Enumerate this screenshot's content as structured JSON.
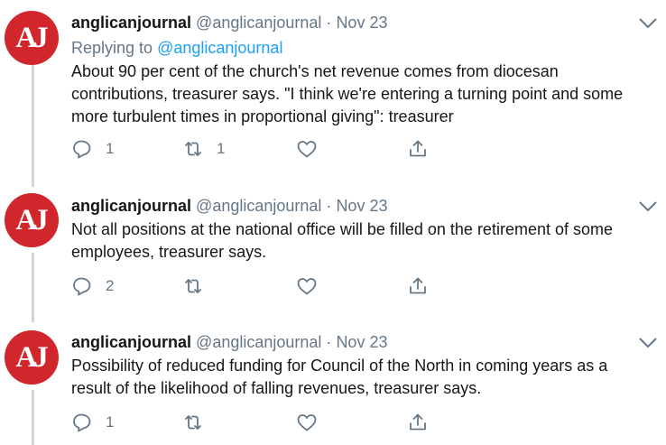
{
  "tweets": [
    {
      "avatar_text": "AJ",
      "name": "anglicanjournal",
      "handle": "@anglicanjournal",
      "separator": "·",
      "date": "Nov 23",
      "replying_label": "Replying to",
      "replying_to": "@anglicanjournal",
      "text_lines": [
        "About 90 per cent of the church's net revenue comes from diocesan",
        "contributions, treasurer says. \"I think we're entering a turning point and some",
        "more turbulent times in proportional giving\": treasurer"
      ],
      "reply_count": "1",
      "retweet_count": "1",
      "like_count": ""
    },
    {
      "avatar_text": "AJ",
      "name": "anglicanjournal",
      "handle": "@anglicanjournal",
      "separator": "·",
      "date": "Nov 23",
      "text_lines": [
        "Not all positions at the national office will be filled on the retirement of some",
        "employees, treasurer says."
      ],
      "reply_count": "2",
      "retweet_count": "",
      "like_count": ""
    },
    {
      "avatar_text": "AJ",
      "name": "anglicanjournal",
      "handle": "@anglicanjournal",
      "separator": "·",
      "date": "Nov 23",
      "text_lines": [
        "Possibility of reduced funding for Council of the North in coming years as a",
        "result of the likelihood of falling revenues, treasurer says."
      ],
      "reply_count": "1",
      "retweet_count": "",
      "like_count": ""
    }
  ],
  "icons": {
    "reply": "reply-icon",
    "retweet": "retweet-icon",
    "like": "heart-icon",
    "share": "share-icon",
    "caret": "chevron-down-icon"
  },
  "colors": {
    "avatar": "#d1272c",
    "link": "#1da1f2",
    "secondary_text": "#657786",
    "thread_line": "#ccd6dd"
  }
}
